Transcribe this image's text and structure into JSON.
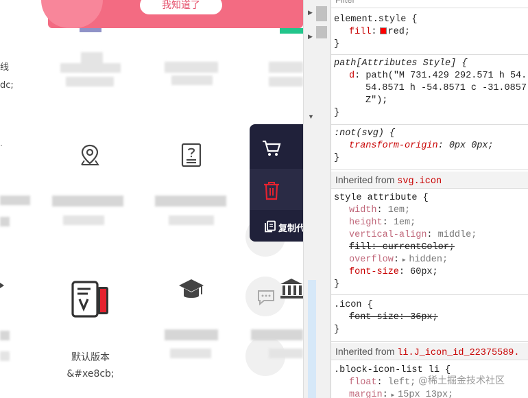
{
  "preview": {
    "banner_button": "我知道了",
    "side_text_1": "线",
    "side_text_2": "dc;",
    "label_default_version": "默认版本",
    "label_entity": "&#xe8cb;",
    "popup_copy": "复制代"
  },
  "devtools": {
    "filter_placeholder": "Filter",
    "element_style": {
      "selector": "element.style {",
      "prop": "fill",
      "value": "red;"
    },
    "path_rule": {
      "selector": "path[Attributes Style] {",
      "prop": "d",
      "line1": "path(\"M 731.429 292.571 h 54.",
      "line2": "54.8571 h -54.8571 c -31.0857",
      "line3": "Z\");"
    },
    "not_svg": {
      "selector": ":not(svg) {",
      "prop": "transform-origin",
      "value": "0px 0px;"
    },
    "inherited_1": {
      "label": "Inherited from",
      "from": "svg.icon"
    },
    "style_attribute": {
      "selector": "style attribute {",
      "props": [
        {
          "name": "width",
          "value": "1em;"
        },
        {
          "name": "height",
          "value": "1em;"
        },
        {
          "name": "vertical-align",
          "value": "middle;"
        },
        {
          "name": "fill",
          "value": "currentColor;"
        },
        {
          "name": "overflow",
          "value": "hidden;"
        },
        {
          "name": "font-size",
          "value": "60px;"
        }
      ]
    },
    "icon_rule": {
      "selector": ".icon {",
      "prop": "font-size",
      "value": "36px;"
    },
    "inherited_2": {
      "label": "Inherited from",
      "from": "li.J_icon_id_22375589."
    },
    "block_rule": {
      "selector": ".block-icon-list li {",
      "prop1": "float",
      "val1": "left;",
      "prop2": "margin",
      "val2": "15px 13px;"
    },
    "close": "}",
    "watermark": "@稀土掘金技术社区"
  },
  "colors": {
    "banner": "#f36b82",
    "popup": "#20213a",
    "trash": "#e5222f",
    "prop_red": "#c80000"
  }
}
